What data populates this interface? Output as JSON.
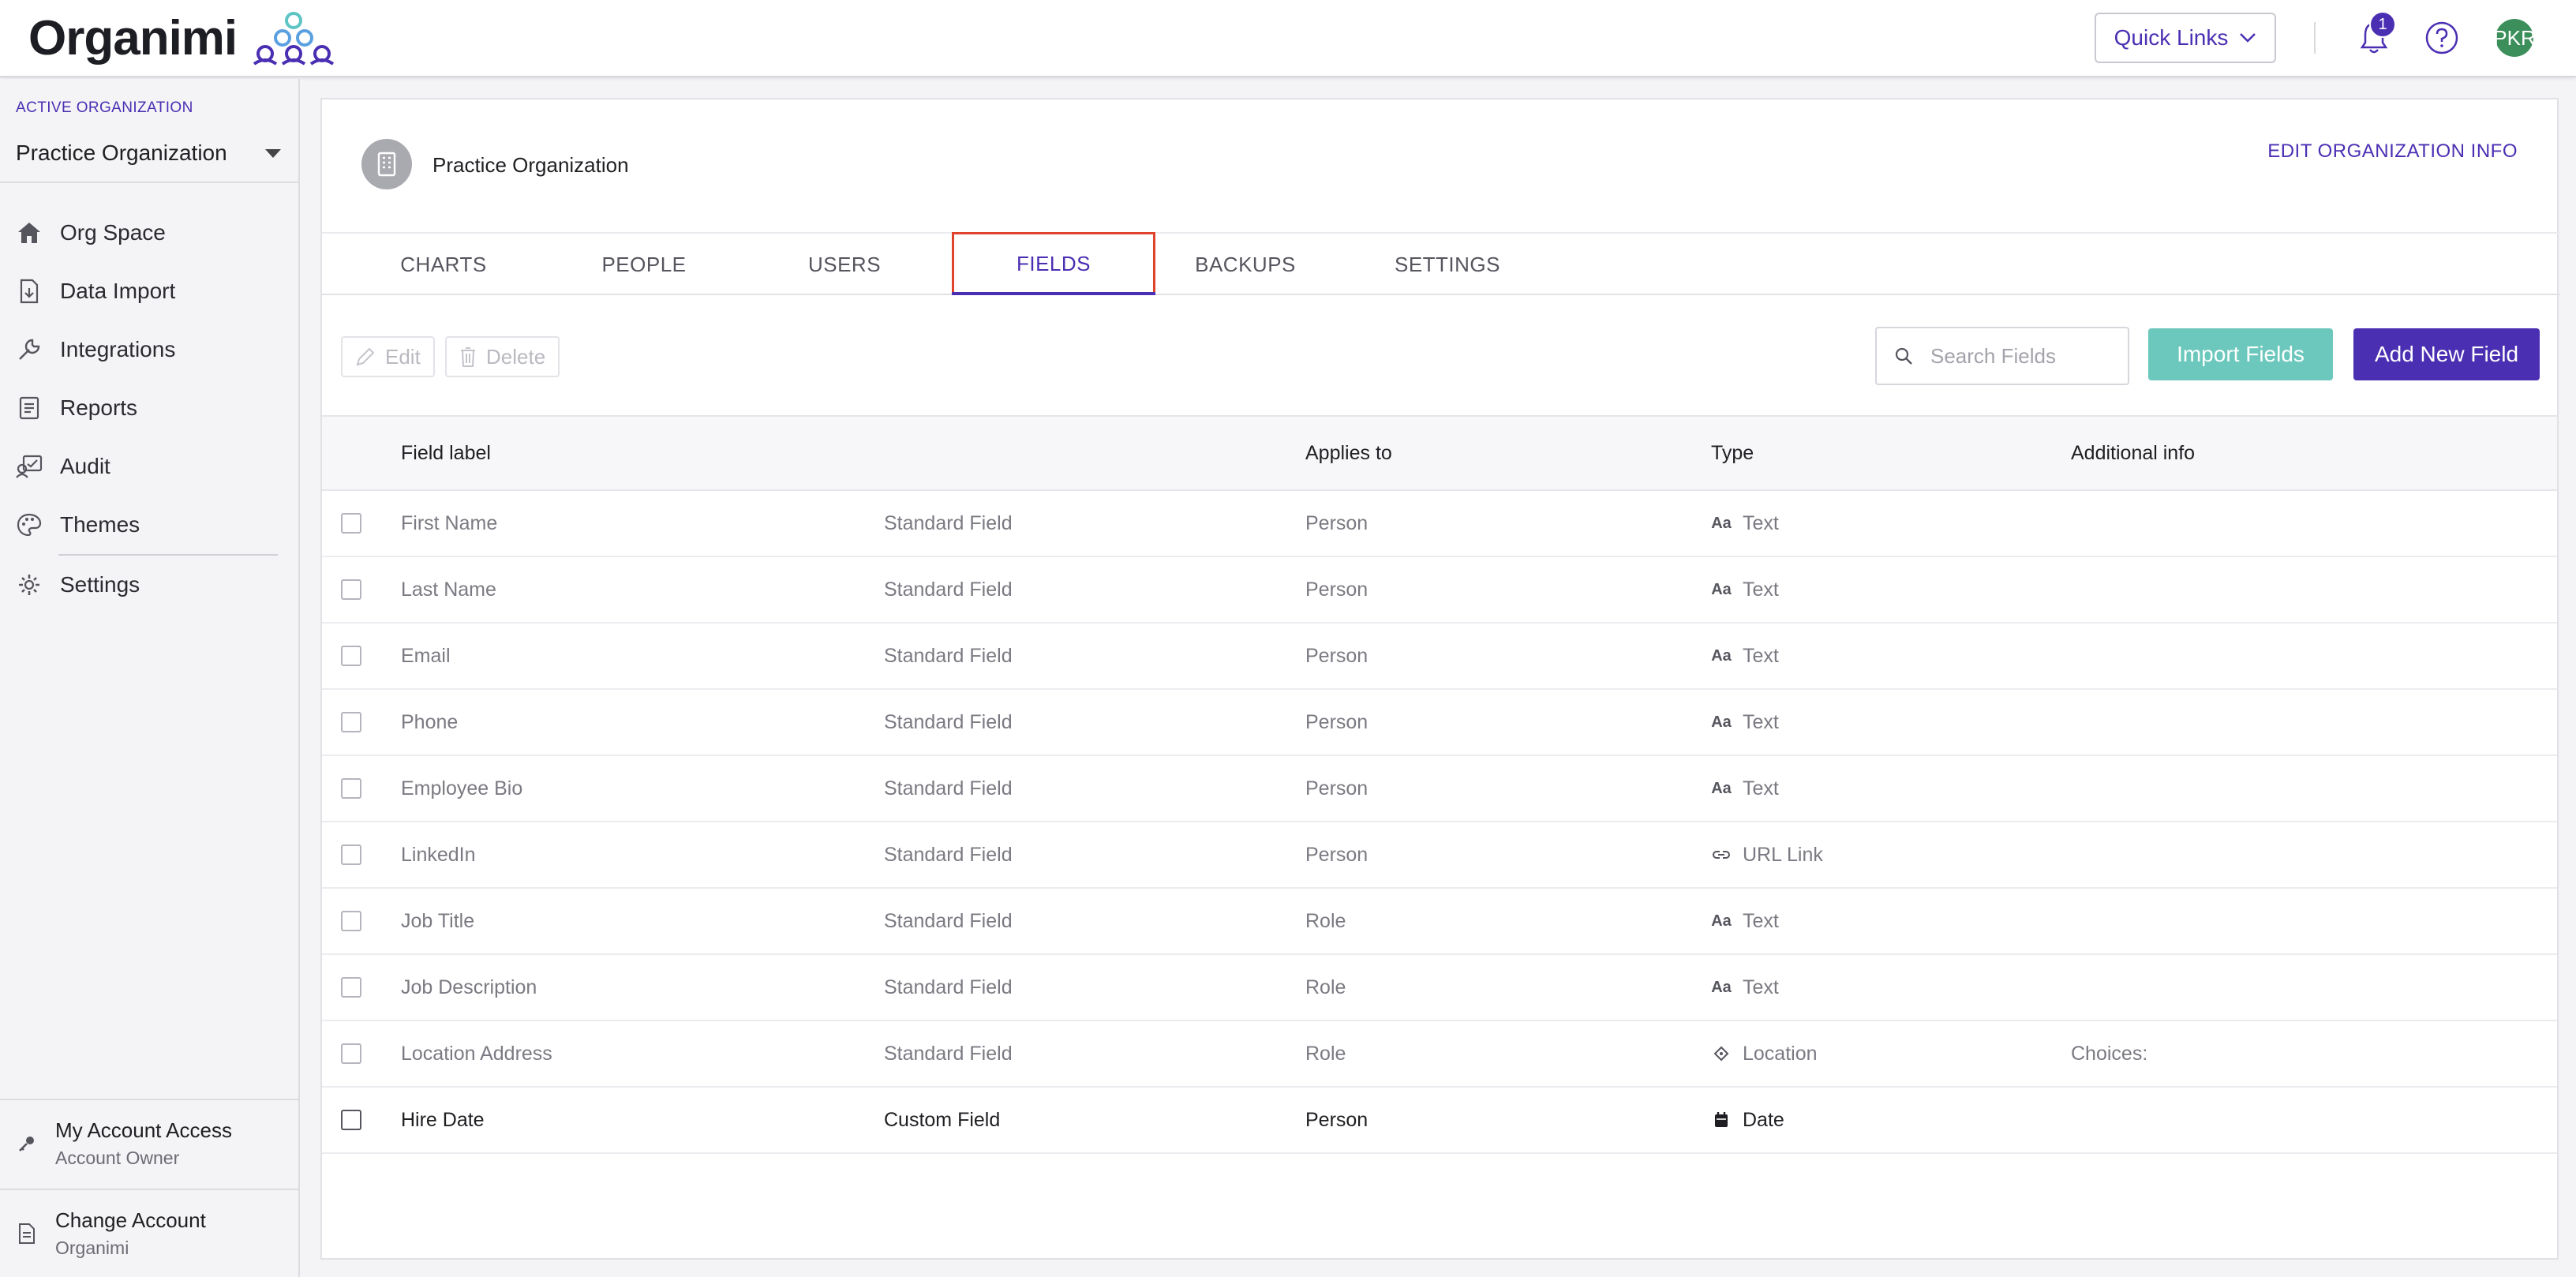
{
  "app": {
    "logo_text": "Organimi",
    "quick_links": "Quick Links",
    "notification_count": "1",
    "avatar_initials": "PKR"
  },
  "sidebar": {
    "active_org_label": "ACTIVE ORGANIZATION",
    "active_org_name": "Practice Organization",
    "nav": [
      {
        "label": "Org Space",
        "icon": "home-icon"
      },
      {
        "label": "Data Import",
        "icon": "file-import-icon"
      },
      {
        "label": "Integrations",
        "icon": "wrench-icon"
      },
      {
        "label": "Reports",
        "icon": "report-icon"
      },
      {
        "label": "Audit",
        "icon": "audit-icon"
      },
      {
        "label": "Themes",
        "icon": "palette-icon"
      },
      {
        "label": "Settings",
        "icon": "gear-icon"
      }
    ],
    "account_access": {
      "title": "My Account Access",
      "subtitle": "Account Owner"
    },
    "change_account": {
      "title": "Change Account",
      "subtitle": "Organimi"
    }
  },
  "header": {
    "org_name": "Practice Organization",
    "edit_link": "EDIT ORGANIZATION INFO"
  },
  "tabs": [
    {
      "label": "CHARTS"
    },
    {
      "label": "PEOPLE"
    },
    {
      "label": "USERS"
    },
    {
      "label": "FIELDS",
      "active": true
    },
    {
      "label": "BACKUPS"
    },
    {
      "label": "SETTINGS"
    }
  ],
  "toolbar": {
    "edit_label": "Edit",
    "delete_label": "Delete",
    "search_placeholder": "Search Fields",
    "import_label": "Import Fields",
    "add_label": "Add New Field"
  },
  "colors": {
    "accent": "#4b2fb3",
    "import_button": "#6cc8bd",
    "highlight_border": "#e0432c",
    "avatar": "#3c8f5a"
  },
  "table": {
    "headers": {
      "label": "Field label",
      "applies": "Applies to",
      "type": "Type",
      "info": "Additional info"
    },
    "rows": [
      {
        "label": "First Name",
        "kind": "Standard Field",
        "applies": "Person",
        "type_icon": "Aa",
        "type": "Text",
        "info": ""
      },
      {
        "label": "Last Name",
        "kind": "Standard Field",
        "applies": "Person",
        "type_icon": "Aa",
        "type": "Text",
        "info": ""
      },
      {
        "label": "Email",
        "kind": "Standard Field",
        "applies": "Person",
        "type_icon": "Aa",
        "type": "Text",
        "info": ""
      },
      {
        "label": "Phone",
        "kind": "Standard Field",
        "applies": "Person",
        "type_icon": "Aa",
        "type": "Text",
        "info": ""
      },
      {
        "label": "Employee Bio",
        "kind": "Standard Field",
        "applies": "Person",
        "type_icon": "Aa",
        "type": "Text",
        "info": ""
      },
      {
        "label": "LinkedIn",
        "kind": "Standard Field",
        "applies": "Person",
        "type_icon": "link",
        "type": "URL Link",
        "info": ""
      },
      {
        "label": "Job Title",
        "kind": "Standard Field",
        "applies": "Role",
        "type_icon": "Aa",
        "type": "Text",
        "info": ""
      },
      {
        "label": "Job Description",
        "kind": "Standard Field",
        "applies": "Role",
        "type_icon": "Aa",
        "type": "Text",
        "info": ""
      },
      {
        "label": "Location Address",
        "kind": "Standard Field",
        "applies": "Role",
        "type_icon": "location",
        "type": "Location",
        "info": "Choices:"
      },
      {
        "label": "Hire Date",
        "kind": "Custom Field",
        "applies": "Person",
        "type_icon": "calendar",
        "type": "Date",
        "info": ""
      }
    ]
  }
}
